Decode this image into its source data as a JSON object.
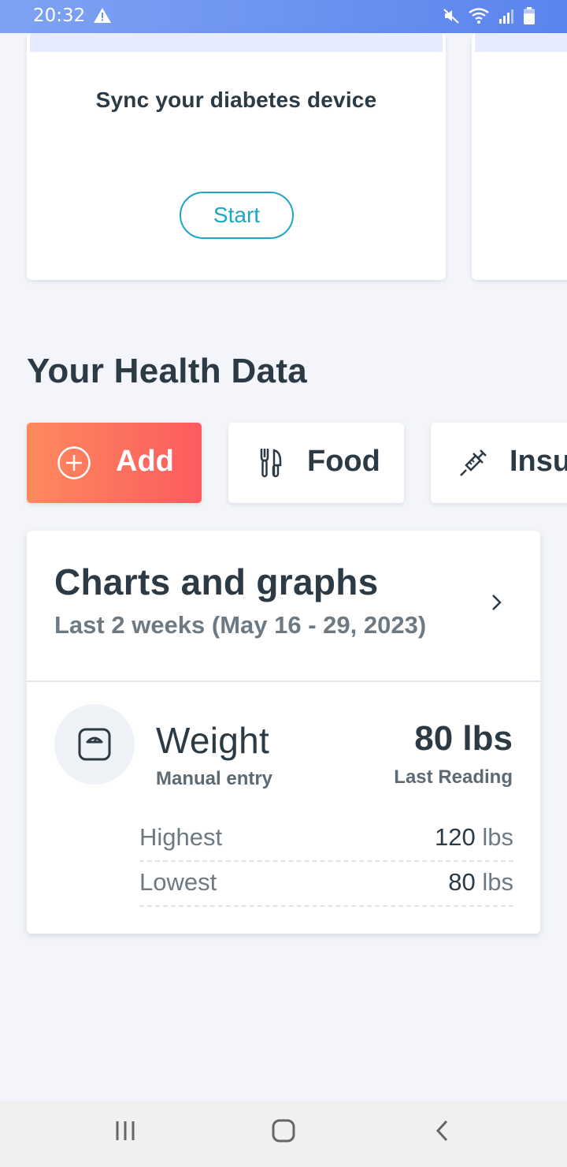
{
  "status_bar": {
    "time": "20:32",
    "icons": [
      "warning-icon",
      "mute-icon",
      "wifi-icon",
      "signal-icon",
      "battery-icon"
    ]
  },
  "promo": {
    "text": "Sync your diabetes device",
    "button_label": "Start"
  },
  "health": {
    "title": "Your Health Data",
    "chips": [
      {
        "label": "Add",
        "icon": "plus-circle-icon"
      },
      {
        "label": "Food",
        "icon": "utensils-icon"
      },
      {
        "label": "Insu",
        "icon": "syringe-icon"
      }
    ]
  },
  "charts": {
    "title": "Charts and graphs",
    "subtitle": "Last 2 weeks (May 16 - 29, 2023)",
    "weight": {
      "title": "Weight",
      "source": "Manual entry",
      "value": "80 lbs",
      "caption": "Last Reading",
      "highest_label": "Highest",
      "highest_value": "120",
      "highest_unit": "lbs",
      "lowest_label": "Lowest",
      "lowest_value": "80",
      "lowest_unit": "lbs"
    }
  },
  "colors": {
    "accent": "#1ea7c5",
    "add_gradient_start": "#fd8a5e",
    "add_gradient_end": "#fc5b5f",
    "status_bar": "#6b92f0"
  }
}
